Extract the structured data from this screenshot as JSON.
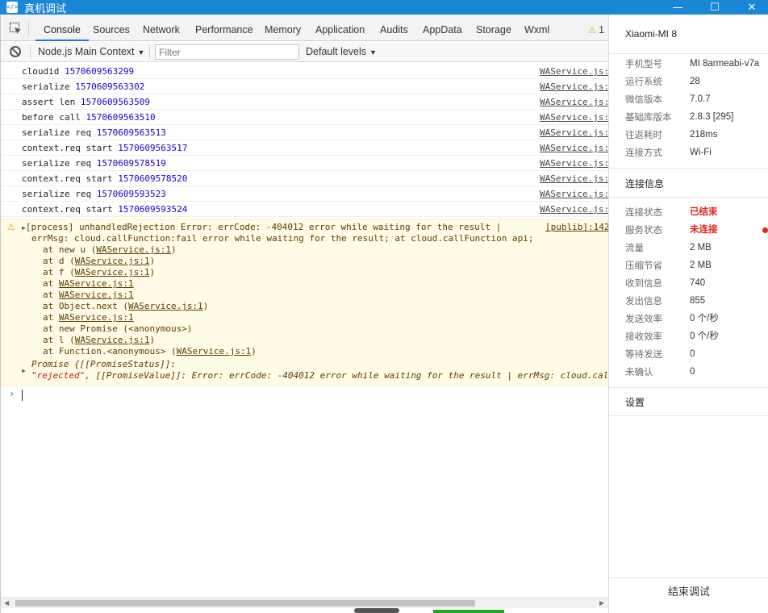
{
  "window": {
    "title": "真机调试",
    "app_icon": "</>",
    "minimize": "—",
    "maximize": "☐",
    "close": "✕"
  },
  "tabs": [
    {
      "label": "Console",
      "active": true
    },
    {
      "label": "Sources"
    },
    {
      "label": "Network"
    },
    {
      "label": "Performance"
    },
    {
      "label": "Memory"
    },
    {
      "label": "Application"
    },
    {
      "label": "Audits"
    },
    {
      "label": "AppData"
    },
    {
      "label": "Storage"
    },
    {
      "label": "Wxml"
    }
  ],
  "warning_count": "1",
  "toolbar": {
    "context": "Node.js Main Context",
    "filter_placeholder": "Filter",
    "levels": "Default levels"
  },
  "logs": [
    {
      "text": "cloudid ",
      "num": "1570609563299",
      "src": "WAService.js:"
    },
    {
      "text": "serialize ",
      "num": "1570609563302",
      "src": "WAService.js:"
    },
    {
      "text": "assert len ",
      "num": "1570609563509",
      "src": "WAService.js:"
    },
    {
      "text": "before call ",
      "num": "1570609563510",
      "src": "WAService.js:"
    },
    {
      "text": "serialize req ",
      "num": "1570609563513",
      "src": "WAService.js:"
    },
    {
      "text": "context.req start ",
      "num": "1570609563517",
      "src": "WAService.js:"
    },
    {
      "text": "serialize req ",
      "num": "1570609578519",
      "src": "WAService.js:"
    },
    {
      "text": "context.req start ",
      "num": "1570609578520",
      "src": "WAService.js:"
    },
    {
      "text": "serialize req ",
      "num": "1570609593523",
      "src": "WAService.js:"
    },
    {
      "text": "context.req start ",
      "num": "1570609593524",
      "src": "WAService.js:"
    }
  ],
  "warning": {
    "line1": "[process] unhandledRejection Error: errCode: -404012 error while waiting for the result |",
    "src": "[publib]:142",
    "line2": "errMsg: cloud.callFunction:fail error while waiting for the result; at cloud.callFunction api;",
    "stack": [
      {
        "pre": "at new u (",
        "link": "WAService.js:1",
        "post": ")"
      },
      {
        "pre": "at d (",
        "link": "WAService.js:1",
        "post": ")"
      },
      {
        "pre": "at f (",
        "link": "WAService.js:1",
        "post": ")"
      },
      {
        "pre": "at ",
        "link": "WAService.js:1",
        "post": ""
      },
      {
        "pre": "at ",
        "link": "WAService.js:1",
        "post": ""
      },
      {
        "pre": "at Object.next (",
        "link": "WAService.js:1",
        "post": ")"
      },
      {
        "pre": "at ",
        "link": "WAService.js:1",
        "post": ""
      },
      {
        "pre": "at new Promise (<anonymous>)",
        "link": "",
        "post": ""
      },
      {
        "pre": "at l (",
        "link": "WAService.js:1",
        "post": ")"
      },
      {
        "pre": "at Function.<anonymous> (",
        "link": "WAService.js:1",
        "post": ")"
      }
    ],
    "promise_line": "Promise {[[PromiseStatus]]:",
    "promise_status": "\"rejected\"",
    "promise_value": ", [[PromiseValue]]: Error: errCode: -404012 error while waiting for the result | errMsg: cloud.call"
  },
  "prompt": "›",
  "device": {
    "name": "Xiaomi-MI 8",
    "info": [
      {
        "k": "手机型号",
        "v": "MI 8armeabi-v7a"
      },
      {
        "k": "运行系统",
        "v": "28"
      },
      {
        "k": "微信版本",
        "v": "7.0.7"
      },
      {
        "k": "基础库版本",
        "v": "2.8.3 [295]"
      },
      {
        "k": "往返耗时",
        "v": "218ms"
      },
      {
        "k": "连接方式",
        "v": "Wi-Fi"
      }
    ],
    "conn_title": "连接信息",
    "conn": [
      {
        "k": "连接状态",
        "v": "已结束",
        "red": true
      },
      {
        "k": "服务状态",
        "v": "未连接",
        "red": true
      },
      {
        "k": "流量",
        "v": "2 MB"
      },
      {
        "k": "压缩节省",
        "v": "2 MB"
      },
      {
        "k": "收到信息",
        "v": "740"
      },
      {
        "k": "发出信息",
        "v": "855"
      },
      {
        "k": "发送效率",
        "v": "0 个/秒"
      },
      {
        "k": "接收效率",
        "v": "0 个/秒"
      },
      {
        "k": "等待发送",
        "v": "0"
      },
      {
        "k": "未确认",
        "v": "0"
      }
    ],
    "settings": "设置",
    "end_button": "结束调试"
  },
  "colors": {
    "titlebar": "#1a86d6",
    "active_tab": "#1a73e8",
    "warn_bg": "#fffbe6",
    "error_red": "#e1251b"
  }
}
